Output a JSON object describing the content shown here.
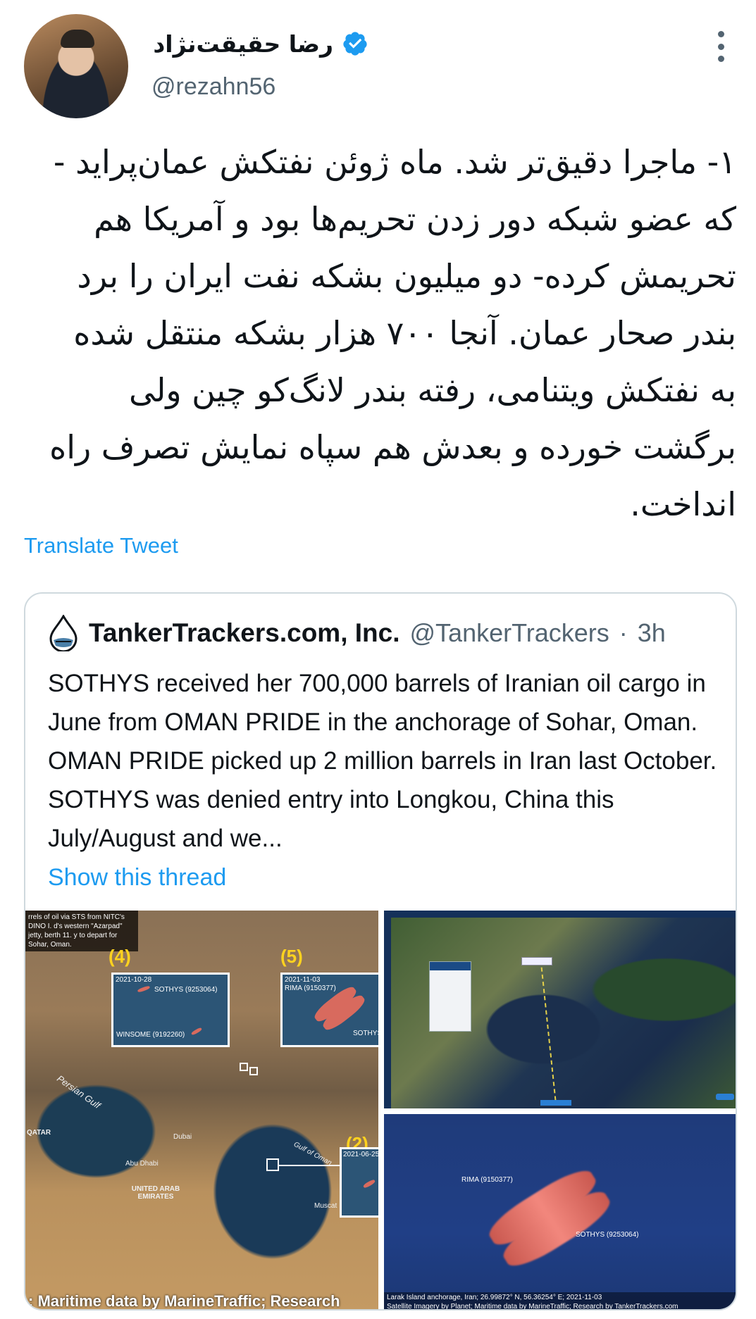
{
  "author": {
    "display_name": "رضا حقیقت‌نژاد",
    "handle": "@rezahn56"
  },
  "tweet": {
    "text": "۱- ماجرا دقیق‌تر شد. ماه ژوئن نفتکش عمان‌پراید - که عضو شبکه دور زدن تحریم‌ها بود و آمریکا هم تحریمش کرده- دو میلیون بشکه نفت ایران را برد بندر صحار عمان. آنجا ۷۰۰ هزار بشکه منتقل شده به نفتکش ویتنامی، رفته بندر لانگ‌کو چین ولی برگشت خورده و بعدش هم سپاه نمایش تصرف راه انداخت.",
    "translate_label": "Translate Tweet"
  },
  "quote": {
    "name": "TankerTrackers.com, Inc.",
    "handle": "@TankerTrackers",
    "dot": "·",
    "time": "3h",
    "text": "SOTHYS received her 700,000 barrels of Iranian oil cargo in June from OMAN PRIDE in the anchorage of Sohar, Oman. OMAN PRIDE picked up 2 million barrels in Iran last October. SOTHYS was denied entry into Longkou, China this July/August and we...",
    "show_thread": "Show this thread"
  },
  "media": {
    "map": {
      "caption_top": "rrels of oil via STS from NITC's DINO I. d's western \"Azarpad\" jetty, berth 11. y to depart for Sohar, Oman.",
      "label_4": "(4)",
      "label_5": "(5)",
      "label_2": "(2)",
      "inset4_date": "2021-10-28",
      "inset4_ship1": "SOTHYS (9253064)",
      "inset4_ship2": "WINSOME (9192260)",
      "inset5_date": "2021-11-03",
      "inset5_ship1": "RIMA (9150377)",
      "inset5_ship2": "SOTHYS (92530",
      "inset2_date": "2021-06-25",
      "place_persian_gulf": "Persian Gulf",
      "place_dubai": "Dubai",
      "place_abu_dhabi": "Abu Dhabi",
      "place_uae": "UNITED ARAB EMIRATES",
      "place_qatar": "QATAR",
      "place_muscat": "Muscat",
      "place_gulf_oman": "Gulf of Oman",
      "footer": ": Maritime data by MarineTraffic; Research"
    },
    "ships": {
      "rima": "RIMA (9150377)",
      "sothys": "SOTHYS (9253064)",
      "footer_line1": "Larak Island anchorage, Iran; 26.99872° N, 56.36254° E; 2021-11-03",
      "footer_line2": "Satellite Imagery by Planet; Maritime data by MarineTraffic; Research by TankerTrackers.com"
    }
  },
  "colors": {
    "accent": "#1d9bf0",
    "text": "#0f1419",
    "muted": "#536471",
    "border": "#cfd9de"
  },
  "icons": [
    "verified-badge-icon",
    "more-options-icon",
    "tankertrackers-logo-icon"
  ]
}
